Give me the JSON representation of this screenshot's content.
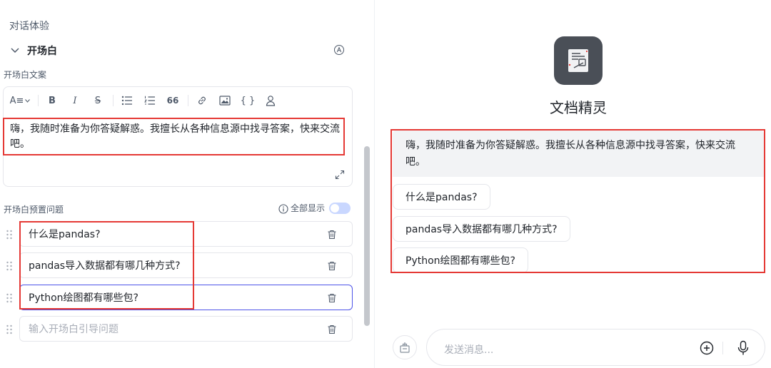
{
  "left_panel": {
    "section_title": "对话体验",
    "opening": {
      "title": "开场白",
      "copy_label": "开场白文案",
      "toolbar": {
        "text_style": "A≡",
        "bold": "B",
        "italic": "I",
        "strike": "S",
        "quote": "66",
        "code": "{ }"
      },
      "text": "嗨，我随时准备为你答疑解惑。我擅长从各种信息源中找寻答案，快来交流吧。",
      "questions_label": "开场白预置问题",
      "show_all_label": "全部显示",
      "questions": [
        {
          "text": "什么是pandas?"
        },
        {
          "text": "pandas导入数据都有哪几种方式?"
        },
        {
          "text": "Python绘图都有哪些包?"
        }
      ],
      "new_question_placeholder": "输入开场白引导问题"
    }
  },
  "preview": {
    "bot_name": "文档精灵",
    "welcome_message": "嗨，我随时准备为你答疑解惑。我擅长从各种信息源中找寻答案，快来交流吧。",
    "suggested_questions": [
      {
        "text": "什么是pandas?"
      },
      {
        "text": "pandas导入数据都有哪几种方式?"
      },
      {
        "text": "Python绘图都有哪些包?"
      }
    ],
    "input_placeholder": "发送消息..."
  },
  "colors": {
    "accent": "#4d53e8",
    "highlight_box": "#e53935",
    "welcome_bg": "#f2f3f5"
  }
}
